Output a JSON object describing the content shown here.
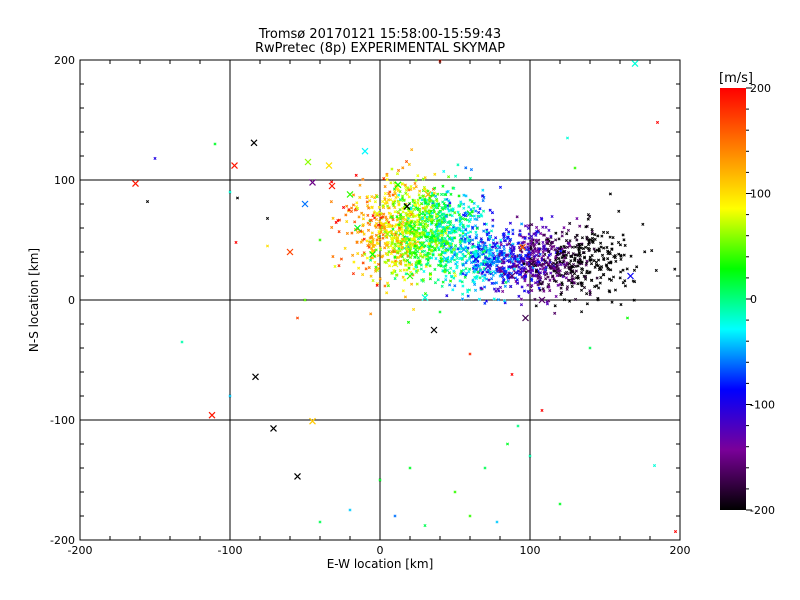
{
  "chart_data": {
    "type": "scatter",
    "title": "Tromsø 20170121 15:58:00-15:59:43",
    "subtitle": "RwPretec (8p) EXPERIMENTAL SKYMAP",
    "xlabel": "E-W location [km]",
    "ylabel": "N-S location [km]",
    "xlim": [
      -200,
      200
    ],
    "ylim": [
      -200,
      200
    ],
    "xticks": [
      -200,
      -100,
      0,
      100,
      200
    ],
    "yticks": [
      -200,
      -100,
      0,
      100,
      200
    ],
    "grid": true,
    "colorbar": {
      "label": "[m/s]",
      "range": [
        -200,
        200
      ],
      "ticks": [
        -200,
        -100,
        0,
        100,
        200
      ],
      "colormap": [
        "#000000",
        "#7a0099",
        "#0000ff",
        "#00ffff",
        "#00ff00",
        "#ffff00",
        "#ff8000",
        "#ff0000"
      ]
    },
    "cross_markers": [
      {
        "x": -163,
        "y": 97,
        "v": 190
      },
      {
        "x": -97,
        "y": 112,
        "v": 190
      },
      {
        "x": -84,
        "y": 131,
        "v": -200
      },
      {
        "x": -112,
        "y": -96,
        "v": 190
      },
      {
        "x": -83,
        "y": -64,
        "v": -200
      },
      {
        "x": -71,
        "y": -107,
        "v": -200
      },
      {
        "x": -55,
        "y": -147,
        "v": -200
      },
      {
        "x": -60,
        "y": 40,
        "v": 170
      },
      {
        "x": -45,
        "y": 98,
        "v": -150
      },
      {
        "x": -32,
        "y": 95,
        "v": 190
      },
      {
        "x": 36,
        "y": -25,
        "v": -200
      },
      {
        "x": 97,
        "y": -15,
        "v": -170
      },
      {
        "x": 170,
        "y": 197,
        "v": -20
      },
      {
        "x": 167,
        "y": 20,
        "v": -90
      },
      {
        "x": -48,
        "y": 115,
        "v": 60
      },
      {
        "x": -34,
        "y": 112,
        "v": 100
      },
      {
        "x": -10,
        "y": 124,
        "v": -30
      },
      {
        "x": -20,
        "y": 88,
        "v": 40
      },
      {
        "x": -15,
        "y": 60,
        "v": 20
      },
      {
        "x": -2,
        "y": 72,
        "v": 80
      },
      {
        "x": 5,
        "y": 55,
        "v": 60
      },
      {
        "x": 12,
        "y": 96,
        "v": 30
      },
      {
        "x": 18,
        "y": 78,
        "v": -200
      },
      {
        "x": 22,
        "y": 60,
        "v": 20
      },
      {
        "x": 28,
        "y": 46,
        "v": 10
      },
      {
        "x": 32,
        "y": 88,
        "v": 120
      },
      {
        "x": 40,
        "y": 70,
        "v": 0
      },
      {
        "x": 48,
        "y": 58,
        "v": -20
      },
      {
        "x": 56,
        "y": 42,
        "v": -50
      },
      {
        "x": 64,
        "y": 34,
        "v": -90
      },
      {
        "x": 72,
        "y": 28,
        "v": -110
      },
      {
        "x": 80,
        "y": 26,
        "v": -140
      },
      {
        "x": 88,
        "y": 20,
        "v": -160
      },
      {
        "x": 95,
        "y": 44,
        "v": 160
      },
      {
        "x": 101,
        "y": 30,
        "v": -180
      },
      {
        "x": 108,
        "y": 0,
        "v": -160
      },
      {
        "x": 60,
        "y": 72,
        "v": 20
      },
      {
        "x": 44,
        "y": 34,
        "v": -40
      },
      {
        "x": -50,
        "y": 80,
        "v": -60
      },
      {
        "x": 30,
        "y": 2,
        "v": -20
      },
      {
        "x": 20,
        "y": 20,
        "v": 40
      },
      {
        "x": -5,
        "y": 38,
        "v": 30
      },
      {
        "x": 10,
        "y": 30,
        "v": 80
      },
      {
        "x": -45,
        "y": -101,
        "v": 110
      }
    ],
    "cluster": {
      "approximate_count": 2400,
      "x_range": [
        -60,
        160
      ],
      "y_range": [
        -20,
        140
      ],
      "velocity_trend": "green/yellow near center (~0 to +120 m/s), grading to blue/purple/black toward east (x > 70 km, ~-100 to -200 m/s)"
    },
    "sparse_points": [
      {
        "x": 185,
        "y": 148,
        "v": 200
      },
      {
        "x": 183,
        "y": -138,
        "v": -20
      },
      {
        "x": 197,
        "y": -193,
        "v": 200
      },
      {
        "x": 88,
        "y": -62,
        "v": 200
      },
      {
        "x": 108,
        "y": -92,
        "v": 200
      },
      {
        "x": 40,
        "y": 199,
        "v": 190
      },
      {
        "x": -132,
        "y": -35,
        "v": -10
      },
      {
        "x": -150,
        "y": 118,
        "v": -100
      },
      {
        "x": -110,
        "y": 130,
        "v": 20
      },
      {
        "x": -100,
        "y": -80,
        "v": -40
      },
      {
        "x": -96,
        "y": 48,
        "v": 200
      },
      {
        "x": -40,
        "y": -185,
        "v": 10
      },
      {
        "x": 0,
        "y": -150,
        "v": 20
      },
      {
        "x": 10,
        "y": -180,
        "v": -60
      },
      {
        "x": 30,
        "y": -188,
        "v": 10
      },
      {
        "x": 50,
        "y": -160,
        "v": 40
      },
      {
        "x": 70,
        "y": -140,
        "v": 10
      },
      {
        "x": 85,
        "y": -120,
        "v": 20
      },
      {
        "x": 100,
        "y": -130,
        "v": -10
      },
      {
        "x": 60,
        "y": -180,
        "v": 40
      },
      {
        "x": 78,
        "y": -185,
        "v": -40
      },
      {
        "x": 20,
        "y": -140,
        "v": 20
      },
      {
        "x": -20,
        "y": -175,
        "v": -40
      },
      {
        "x": 92,
        "y": -105,
        "v": 0
      },
      {
        "x": 120,
        "y": -170,
        "v": 20
      },
      {
        "x": -155,
        "y": 82,
        "v": -200
      },
      {
        "x": -95,
        "y": 85,
        "v": -200
      },
      {
        "x": -75,
        "y": 68,
        "v": -200
      },
      {
        "x": -50,
        "y": 0,
        "v": 50
      },
      {
        "x": -55,
        "y": -15,
        "v": 170
      },
      {
        "x": 140,
        "y": -40,
        "v": 10
      },
      {
        "x": 165,
        "y": -15,
        "v": 30
      },
      {
        "x": 125,
        "y": 135,
        "v": -20
      },
      {
        "x": 130,
        "y": 110,
        "v": 40
      },
      {
        "x": 60,
        "y": -45,
        "v": 180
      },
      {
        "x": 40,
        "y": -10,
        "v": 20
      },
      {
        "x": -30,
        "y": 28,
        "v": 80
      },
      {
        "x": -40,
        "y": 50,
        "v": 40
      },
      {
        "x": -100,
        "y": 90,
        "v": -20
      },
      {
        "x": -75,
        "y": 45,
        "v": 100
      }
    ]
  }
}
